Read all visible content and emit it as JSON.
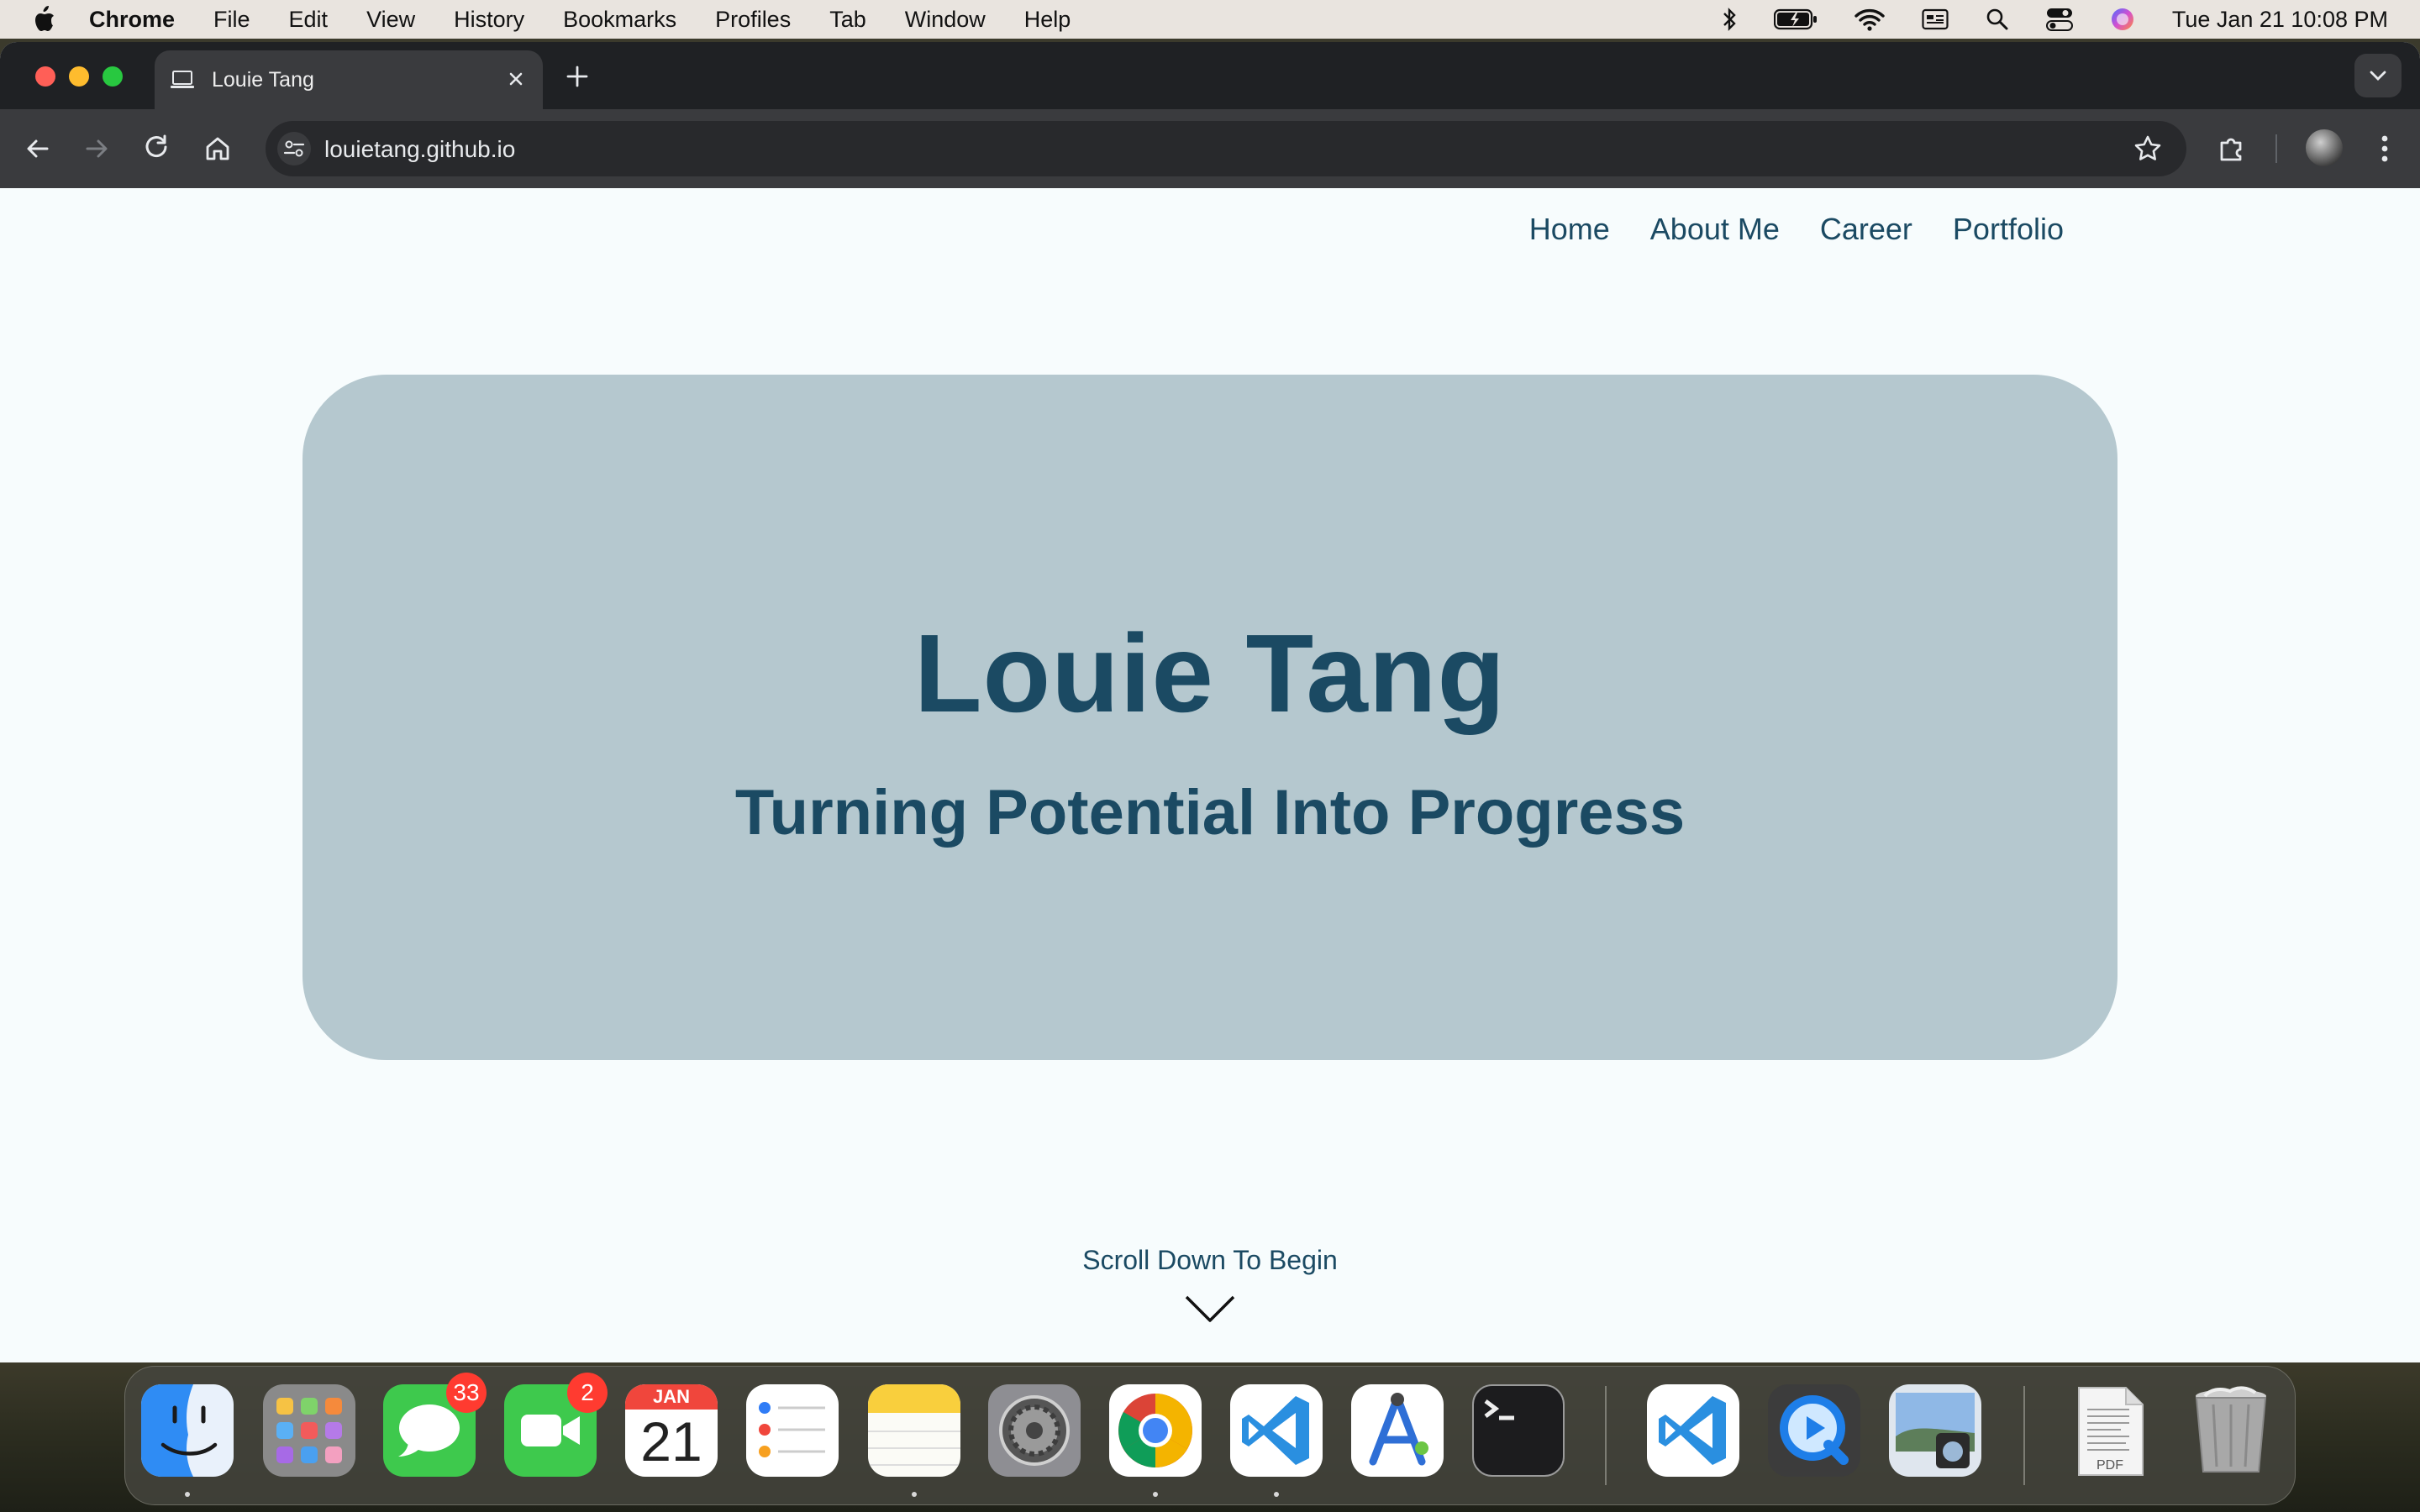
{
  "menubar": {
    "app": "Chrome",
    "items": [
      "File",
      "Edit",
      "View",
      "History",
      "Bookmarks",
      "Profiles",
      "Tab",
      "Window",
      "Help"
    ],
    "clock": "Tue Jan 21  10:08 PM",
    "status_icons": [
      "bluetooth-icon",
      "battery-icon",
      "wifi-icon",
      "display-icon",
      "spotlight-icon",
      "control-center-icon",
      "siri-icon"
    ]
  },
  "browser": {
    "tab_title": "Louie Tang",
    "url": "louietang.github.io"
  },
  "page": {
    "nav": [
      "Home",
      "About Me",
      "Career",
      "Portfolio"
    ],
    "hero_title": "Louie Tang",
    "hero_subtitle": "Turning Potential Into Progress",
    "scroll_cta": "Scroll Down To Begin"
  },
  "dock": {
    "calendar_month": "JAN",
    "calendar_day": "21",
    "messages_badge": "33",
    "facetime_badge": "2",
    "pdf_label": "PDF",
    "apps": [
      "Finder",
      "Launchpad",
      "Messages",
      "FaceTime",
      "Calendar",
      "Reminders",
      "Notes",
      "System Settings",
      "Google Chrome",
      "Visual Studio Code",
      "Instruments",
      "Terminal",
      "Visual Studio Code",
      "QuickTime Player",
      "Preview",
      "PDF Document",
      "Trash"
    ]
  },
  "colors": {
    "accent": "#1b4a63",
    "hero_bg": "#b5c8cf",
    "page_bg": "#f7fcfd"
  }
}
